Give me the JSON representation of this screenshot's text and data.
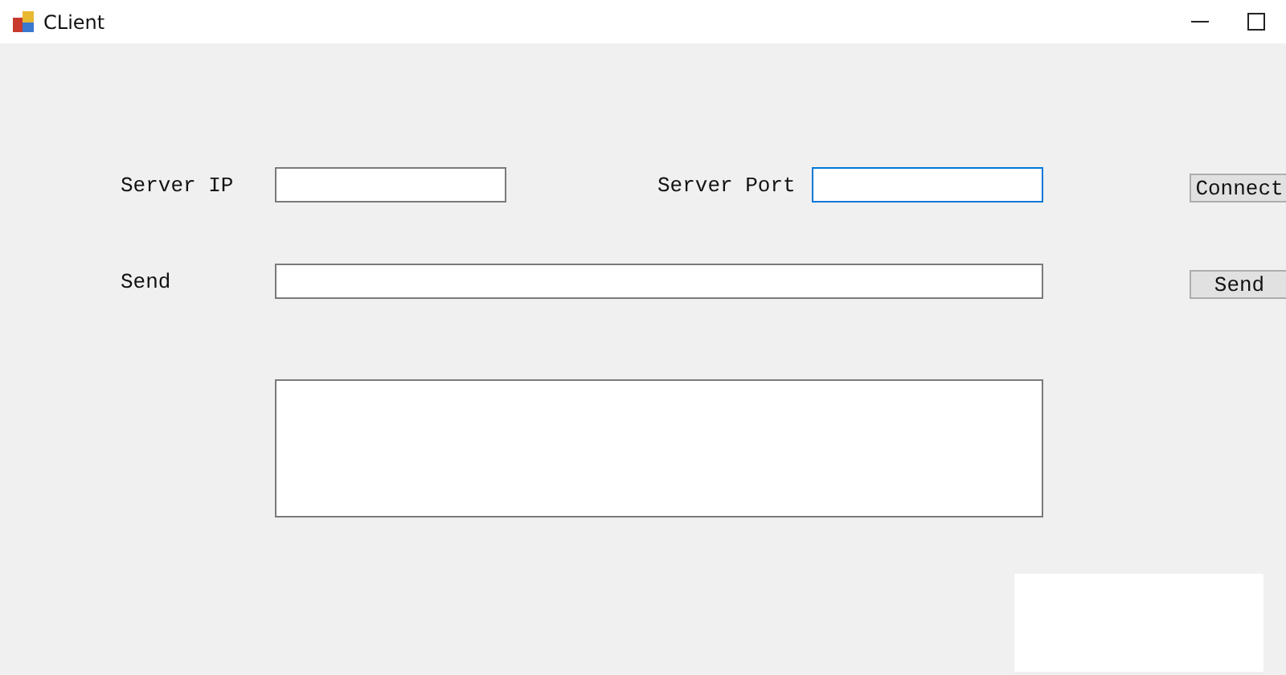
{
  "window": {
    "title": "CLient"
  },
  "server_ip": {
    "label": "Server IP",
    "focused": false
  },
  "server_port": {
    "label": "Server Port",
    "focused": true
  },
  "connect_button": {
    "label": "Connect"
  },
  "send": {
    "label": "Send",
    "focused": false
  },
  "send_button": {
    "label": "Send"
  },
  "log": {
    "focused": false
  }
}
